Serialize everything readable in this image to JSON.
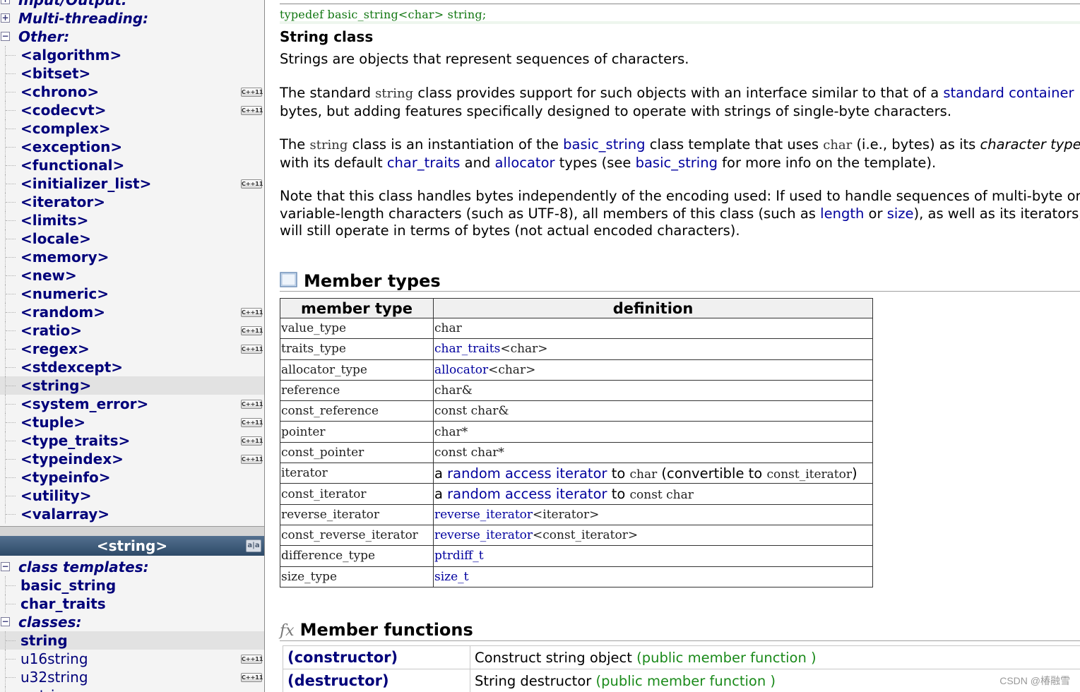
{
  "sidebar": {
    "top_tree": [
      {
        "kind": "cat",
        "expander": "+",
        "label": "Input/Output:"
      },
      {
        "kind": "cat",
        "expander": "+",
        "label": "Multi-threading:"
      },
      {
        "kind": "cat",
        "expander": "−",
        "label": "Other:"
      },
      {
        "kind": "item",
        "label": "<algorithm>",
        "cpp11": false
      },
      {
        "kind": "item",
        "label": "<bitset>",
        "cpp11": false
      },
      {
        "kind": "item",
        "label": "<chrono>",
        "cpp11": true
      },
      {
        "kind": "item",
        "label": "<codecvt>",
        "cpp11": true
      },
      {
        "kind": "item",
        "label": "<complex>",
        "cpp11": false
      },
      {
        "kind": "item",
        "label": "<exception>",
        "cpp11": false
      },
      {
        "kind": "item",
        "label": "<functional>",
        "cpp11": false
      },
      {
        "kind": "item",
        "label": "<initializer_list>",
        "cpp11": true
      },
      {
        "kind": "item",
        "label": "<iterator>",
        "cpp11": false
      },
      {
        "kind": "item",
        "label": "<limits>",
        "cpp11": false
      },
      {
        "kind": "item",
        "label": "<locale>",
        "cpp11": false
      },
      {
        "kind": "item",
        "label": "<memory>",
        "cpp11": false
      },
      {
        "kind": "item",
        "label": "<new>",
        "cpp11": false
      },
      {
        "kind": "item",
        "label": "<numeric>",
        "cpp11": false
      },
      {
        "kind": "item",
        "label": "<random>",
        "cpp11": true
      },
      {
        "kind": "item",
        "label": "<ratio>",
        "cpp11": true
      },
      {
        "kind": "item",
        "label": "<regex>",
        "cpp11": true
      },
      {
        "kind": "item",
        "label": "<stdexcept>",
        "cpp11": false
      },
      {
        "kind": "item",
        "label": "<string>",
        "cpp11": false,
        "selected": true
      },
      {
        "kind": "item",
        "label": "<system_error>",
        "cpp11": true
      },
      {
        "kind": "item",
        "label": "<tuple>",
        "cpp11": true
      },
      {
        "kind": "item",
        "label": "<type_traits>",
        "cpp11": true
      },
      {
        "kind": "item",
        "label": "<typeindex>",
        "cpp11": true
      },
      {
        "kind": "item",
        "label": "<typeinfo>",
        "cpp11": false
      },
      {
        "kind": "item",
        "label": "<utility>",
        "cpp11": false
      },
      {
        "kind": "item",
        "label": "<valarray>",
        "cpp11": false
      }
    ],
    "cpp11_badge": "C++11",
    "lower_header": "<string>",
    "lower_tree": [
      {
        "kind": "cat",
        "expander": "−",
        "label": "class templates:"
      },
      {
        "kind": "item",
        "label": "basic_string",
        "cpp11": false
      },
      {
        "kind": "item",
        "label": "char_traits",
        "cpp11": false
      },
      {
        "kind": "cat",
        "expander": "−",
        "label": "classes:"
      },
      {
        "kind": "item",
        "label": "string",
        "cpp11": false,
        "selected": true
      },
      {
        "kind": "item",
        "label": "u16string",
        "cpp11": true,
        "plain": true
      },
      {
        "kind": "item",
        "label": "u32string",
        "cpp11": true,
        "plain": true
      },
      {
        "kind": "item",
        "label": "wstring",
        "cpp11": false,
        "plain": true
      }
    ]
  },
  "content": {
    "typedef": "typedef basic_string<char> string;",
    "class_title": "String class",
    "para1": "Strings are objects that represent sequences of characters.",
    "para2": {
      "a": "The standard ",
      "b": "string",
      "c": " class provides support for such objects with an interface similar to that of a ",
      "d": "standard container",
      "e": "bytes, but adding features specifically designed to operate with strings of single-byte characters."
    },
    "para3": {
      "a": "The ",
      "b": "string",
      "c": " class is an instantiation of the ",
      "d": "basic_string",
      "e": " class template that uses ",
      "f": "char",
      "g": " (i.e., bytes) as its ",
      "h": "character type",
      "i": "with its default ",
      "j": "char_traits",
      "k": " and ",
      "l": "allocator",
      "m": " types (see ",
      "n": "basic_string",
      "o": " for more info on the template)."
    },
    "para4": {
      "a": "Note that this class handles bytes independently of the encoding used: If used to handle sequences of multi-byte or",
      "b": "variable-length characters (such as UTF-8), all members of this class (such as ",
      "c": "length",
      "d": " or ",
      "e": "size",
      "f": "), as well as its iterators,",
      "g": "will still operate in terms of bytes (not actual encoded characters)."
    },
    "member_types_title": "Member types",
    "types_headers": [
      "member type",
      "definition"
    ],
    "types_rows": [
      [
        "value_type",
        "char"
      ],
      [
        "traits_type",
        "char_traits<char>"
      ],
      [
        "allocator_type",
        "allocator<char>"
      ],
      [
        "reference",
        "char&"
      ],
      [
        "const_reference",
        "const char&"
      ],
      [
        "pointer",
        "char*"
      ],
      [
        "const_pointer",
        "const char*"
      ],
      [
        "iterator",
        "a random access iterator to char (convertible to const_iterator)"
      ],
      [
        "const_iterator",
        "a random access iterator to const char"
      ],
      [
        "reverse_iterator",
        "reverse_iterator<iterator>"
      ],
      [
        "const_reverse_iterator",
        "reverse_iterator<const_iterator>"
      ],
      [
        "difference_type",
        "ptrdiff_t"
      ],
      [
        "size_type",
        "size_t"
      ]
    ],
    "type_defs": {
      "traits_link": "char_traits",
      "traits_rest": "<char>",
      "alloc_link": "allocator",
      "alloc_rest": "<char>",
      "it_a": "a ",
      "it_link": "random access iterator",
      "it_to": " to ",
      "it_char": "char",
      "it_conv": " (convertible to ",
      "it_const": "const_iterator",
      "it_close": ")",
      "cit_a": "a ",
      "cit_link": "random access iterator",
      "cit_to": " to ",
      "cit_char": "const char",
      "rit_link": "reverse_iterator",
      "rit_rest": "<iterator>",
      "crit_link": "reverse_iterator",
      "crit_rest": "<const_iterator>",
      "diff_link": "ptrdiff_t",
      "size_link": "size_t"
    },
    "member_functions_title": "Member functions",
    "functions": [
      {
        "name": "(constructor)",
        "desc": "Construct string object ",
        "note": "(public member function )"
      },
      {
        "name": "(destructor)",
        "desc": "String destructor ",
        "note": "(public member function )"
      }
    ]
  },
  "watermark": "CSDN @椿融雪",
  "colors": {
    "link": "#00009e",
    "nav": "#00007a",
    "typedef": "#127712",
    "note": "#1a8a1a",
    "header_bg": "#3d5a7a"
  },
  "icons": {
    "member_types": "table-icon",
    "member_functions": "function-icon",
    "expand": "plus-box-icon",
    "collapse": "minus-box-icon",
    "lang": "book-icon"
  }
}
